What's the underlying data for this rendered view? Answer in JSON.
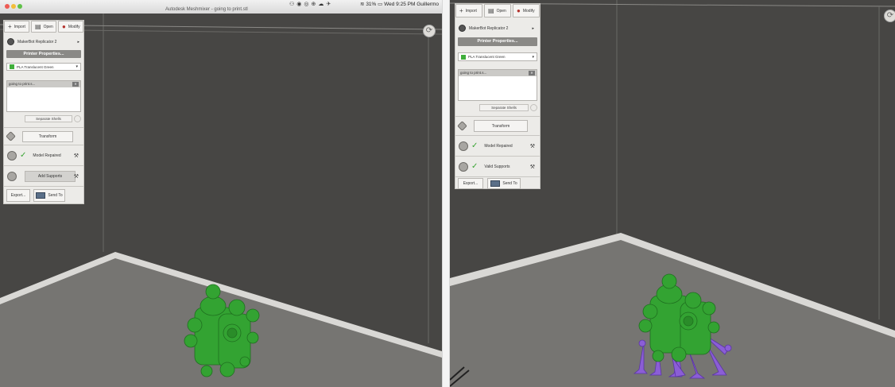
{
  "window": {
    "title": "Autodesk Meshmixer - going to print.stl",
    "menu_status": "31%",
    "clock": "Wed 9:25 PM",
    "user": "Guillermo"
  },
  "toolbar": {
    "import_label": "Import",
    "open_label": "Open",
    "modify_label": "Modify"
  },
  "printer": {
    "name": "MakerBot Replicator 2",
    "properties_label": "Printer Properties...",
    "material": "PLA Translucent Green",
    "material_color": "#3fae3b"
  },
  "objects": {
    "items": [
      "going to print.s..."
    ],
    "separate_label": "Separate Shells"
  },
  "actions": {
    "transform_label": "Transform",
    "model_repaired_label": "Model Repaired",
    "add_supports_label": "Add Supports",
    "valid_supports_label": "Valid Supports",
    "export_label": "Export...",
    "send_to_label": "Send To"
  },
  "colors": {
    "viewport_bg": "#474644",
    "floor": "#767572",
    "floor_edge": "#d9d8d5",
    "model": "#33a332",
    "supports": "#8b5ed6"
  }
}
